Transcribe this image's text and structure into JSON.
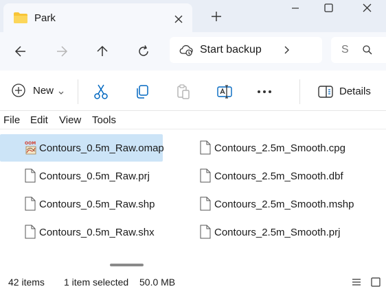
{
  "window": {
    "tab_title": "Park"
  },
  "nav": {
    "address_label": "Start backup",
    "search_placeholder": "S"
  },
  "commands": {
    "new_label": "New",
    "details_label": "Details"
  },
  "menu": [
    "File",
    "Edit",
    "View",
    "Tools"
  ],
  "files": [
    {
      "name": "Contours_0.5m_Raw.omap",
      "icon": "oom-map-icon",
      "selected": true
    },
    {
      "name": "Contours_0.5m_Raw.prj",
      "icon": "file-icon",
      "selected": false
    },
    {
      "name": "Contours_0.5m_Raw.shp",
      "icon": "file-icon",
      "selected": false
    },
    {
      "name": "Contours_0.5m_Raw.shx",
      "icon": "file-icon",
      "selected": false
    },
    {
      "name": "Contours_2.5m_Smooth.cpg",
      "icon": "file-icon",
      "selected": false
    },
    {
      "name": "Contours_2.5m_Smooth.dbf",
      "icon": "file-icon",
      "selected": false
    },
    {
      "name": "Contours_2.5m_Smooth.mshp",
      "icon": "file-icon",
      "selected": false
    },
    {
      "name": "Contours_2.5m_Smooth.prj",
      "icon": "file-icon",
      "selected": false
    }
  ],
  "status": {
    "item_count": "42 items",
    "selection": "1 item selected",
    "size": "50.0 MB"
  },
  "colors": {
    "accent": "#0067c0",
    "selection": "#cce4f7",
    "folder": "#f8c537"
  }
}
